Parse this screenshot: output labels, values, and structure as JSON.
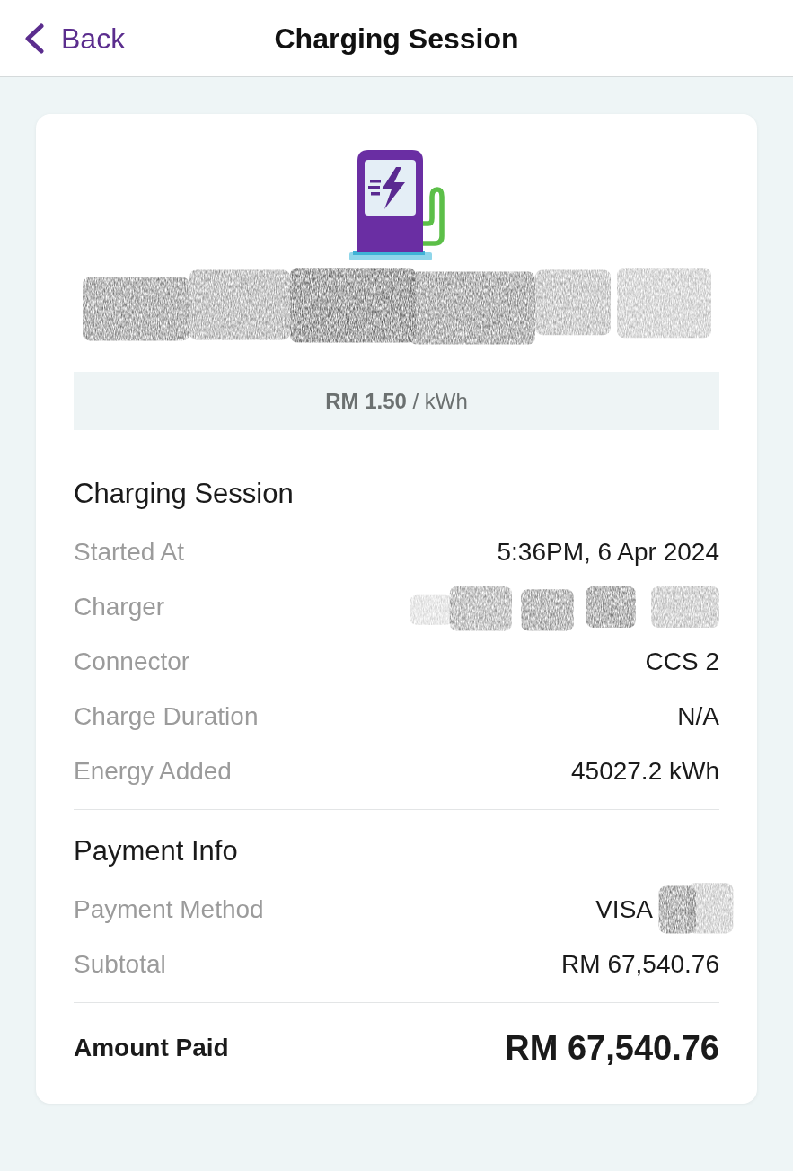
{
  "header": {
    "back_label": "Back",
    "title": "Charging Session"
  },
  "station": {
    "name_redacted": true,
    "price": "**RM 1.50** / kWh"
  },
  "sections": [
    {
      "title": "Charging Session",
      "rows": [
        {
          "label": "Started At",
          "value": "5:36PM, 6 Apr 2024",
          "redacted": false
        },
        {
          "label": "Charger",
          "redacted": true
        },
        {
          "label": "Connector",
          "value": "CCS 2",
          "redacted": false
        },
        {
          "label": "Charge Duration",
          "value": "N/A",
          "redacted": false
        },
        {
          "label": "Energy Added",
          "value": "45027.2 kWh",
          "redacted": false
        }
      ]
    },
    {
      "title": "Payment Info",
      "rows": [
        {
          "label": "Payment Method",
          "value": "VISA",
          "redacted": true
        },
        {
          "label": "Subtotal",
          "value": "RM 67,540.76",
          "redacted": false
        }
      ]
    }
  ],
  "total": {
    "label": "Amount Paid",
    "value": "RM 67,540.76"
  }
}
